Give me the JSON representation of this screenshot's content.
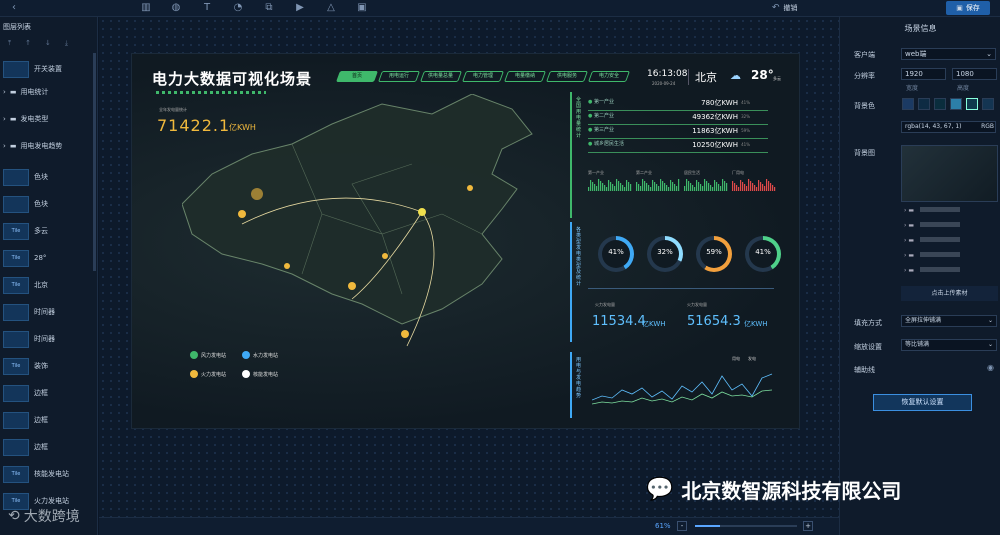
{
  "toolbar": {
    "undo_label": "撤销",
    "save_label": "保存"
  },
  "left_panel": {
    "title": "图层列表",
    "items": [
      {
        "type": "layer",
        "thumb": "",
        "label": "开关装置"
      },
      {
        "type": "folder",
        "label": "用电统计"
      },
      {
        "type": "folder",
        "label": "发电类型"
      },
      {
        "type": "folder",
        "label": "用电发电趋势"
      },
      {
        "type": "layer",
        "thumb": "",
        "label": "色块"
      },
      {
        "type": "layer",
        "thumb": "",
        "label": "色块"
      },
      {
        "type": "layer",
        "thumb": "Tile",
        "label": "多云"
      },
      {
        "type": "layer",
        "thumb": "Tile",
        "label": "28°"
      },
      {
        "type": "layer",
        "thumb": "Tile",
        "label": "北京"
      },
      {
        "type": "layer",
        "thumb": "",
        "label": "时间器"
      },
      {
        "type": "layer",
        "thumb": "",
        "label": "时间器"
      },
      {
        "type": "layer",
        "thumb": "Tile",
        "label": "装饰"
      },
      {
        "type": "layer",
        "thumb": "",
        "label": "边框"
      },
      {
        "type": "layer",
        "thumb": "",
        "label": "边框"
      },
      {
        "type": "layer",
        "thumb": "",
        "label": "边框"
      },
      {
        "type": "layer",
        "thumb": "Tile",
        "label": "核能发电站"
      },
      {
        "type": "layer",
        "thumb": "Tile",
        "label": "火力发电站"
      }
    ]
  },
  "screen": {
    "title": "电力大数据可视化场景",
    "tabs": [
      "首页",
      "用电运行",
      "供电量总量",
      "电力管理",
      "电量缴纳",
      "供电服务",
      "电力安全"
    ],
    "time": "16:13:08",
    "date": "2020-09-24",
    "city": "北京",
    "temperature": "28°",
    "weather": "多云",
    "total_label": "全年发电量统计",
    "total_value": "71422.1",
    "total_unit": "亿KWH",
    "legend": [
      "风力发电站",
      "水力发电站",
      "火力发电站",
      "核能发电站"
    ],
    "section1_label": "全国用电量统计",
    "stats": [
      {
        "label": "第一产业",
        "value": "780亿KWH",
        "pct": "41%"
      },
      {
        "label": "第二产业",
        "value": "49362亿KWH",
        "pct": "32%"
      },
      {
        "label": "第三产业",
        "value": "11863亿KWH",
        "pct": "59%"
      },
      {
        "label": "城乡居民生活",
        "value": "10250亿KWH",
        "pct": "41%"
      }
    ],
    "mini_labels": [
      "第一产业",
      "第二产业",
      "居民生活",
      "厂用电"
    ],
    "section2_label": "各类型发电类型及统计",
    "gauges": [
      {
        "pct": "41%",
        "value": 41,
        "color": "#3fa9f5"
      },
      {
        "pct": "32%",
        "value": 32,
        "color": "#8fdcff"
      },
      {
        "pct": "59%",
        "value": 59,
        "color": "#f2a03d"
      },
      {
        "pct": "41%",
        "value": 41,
        "color": "#4fd18a"
      }
    ],
    "sub_labels": [
      "火力发电量",
      "火力发电量"
    ],
    "sub_values": [
      "11534.4",
      "51654.3"
    ],
    "sub_unit": "亿KWH",
    "section3_label": "用电与发电趋势",
    "trend_legend": [
      "用电",
      "发电"
    ]
  },
  "right_panel": {
    "title": "场景信息",
    "client_label": "客户端",
    "client_value": "web端",
    "resolution_label": "分辨率",
    "width": "1920",
    "height": "1080",
    "width_caption": "宽度",
    "height_caption": "高度",
    "bg_color_label": "背景色",
    "bg_color_value": "rgba(14, 43, 67, 1)",
    "rgb_label": "RGB",
    "bg_image_label": "背景图",
    "files": [
      "",
      "",
      "",
      "",
      ""
    ],
    "upload_label": "点击上传素材",
    "fill_label": "填充方式",
    "fill_value": "全屏拉伸铺满",
    "zoom_label": "缩放设置",
    "zoom_value": "等比铺满",
    "aux_label": "辅助线",
    "reset_label": "恢复默认设置",
    "swatches": [
      "#1b3a63",
      "#0e2b43",
      "#0a2d3d",
      "#2c7fa9",
      "#0f3a4d",
      "#143552"
    ]
  },
  "bottom": {
    "zoom": "61%"
  },
  "watermark": {
    "text": "大数跨境",
    "company": "北京数智源科技有限公司"
  }
}
